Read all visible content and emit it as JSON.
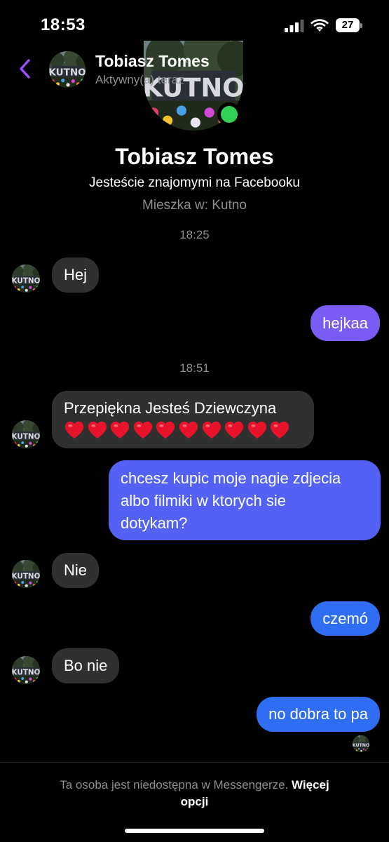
{
  "status_bar": {
    "time": "18:53",
    "battery_level": "27"
  },
  "header": {
    "name": "Tobiasz Tomes",
    "status": "Aktywny(a) teraz"
  },
  "profile": {
    "avatar_text": "KUTNO",
    "name": "Tobiasz Tomes",
    "friends_text": "Jesteście znajomymi na Facebooku",
    "lives_in": "Mieszka w: Kutno"
  },
  "timestamps": [
    "18:25",
    "18:51"
  ],
  "messages": [
    {
      "direction": "incoming",
      "text": "Hej"
    },
    {
      "direction": "outgoing",
      "text": "hejkaa"
    },
    {
      "direction": "incoming",
      "text": "Przepiękna Jesteś Dziewczyna",
      "emoji": "❤️❤️❤️❤️❤️❤️❤️❤️❤️❤️"
    },
    {
      "direction": "outgoing",
      "lines": [
        "chcesz kupic moje nagie zdjecia",
        "albo filmiki w ktorych sie",
        "dotykam?"
      ]
    },
    {
      "direction": "incoming",
      "text": "Nie"
    },
    {
      "direction": "outgoing",
      "text": "czemó"
    },
    {
      "direction": "incoming",
      "text": "Bo nie"
    },
    {
      "direction": "outgoing",
      "text": "no dobra to pa"
    }
  ],
  "footer": {
    "notice": "Ta osoba jest niedostępna w Messengerze.",
    "more_options_line1": "Więcej",
    "more_options_line2": "opcji"
  },
  "colors": {
    "accent": "#9d4eff",
    "bubble_incoming": "#303030",
    "bubble_outgoing_purple": "#7a5cf5",
    "bubble_outgoing_indigo": "#5362f4",
    "bubble_outgoing_blue": "#2f6ef3",
    "online_indicator": "#31d158",
    "heart": "#e8132b"
  },
  "icons": {
    "back": "chevron-left-icon",
    "signal": "cellular-signal-icon",
    "wifi": "wifi-icon",
    "battery": "battery-icon",
    "heart": "red-heart-icon",
    "online": "online-dot-icon"
  }
}
